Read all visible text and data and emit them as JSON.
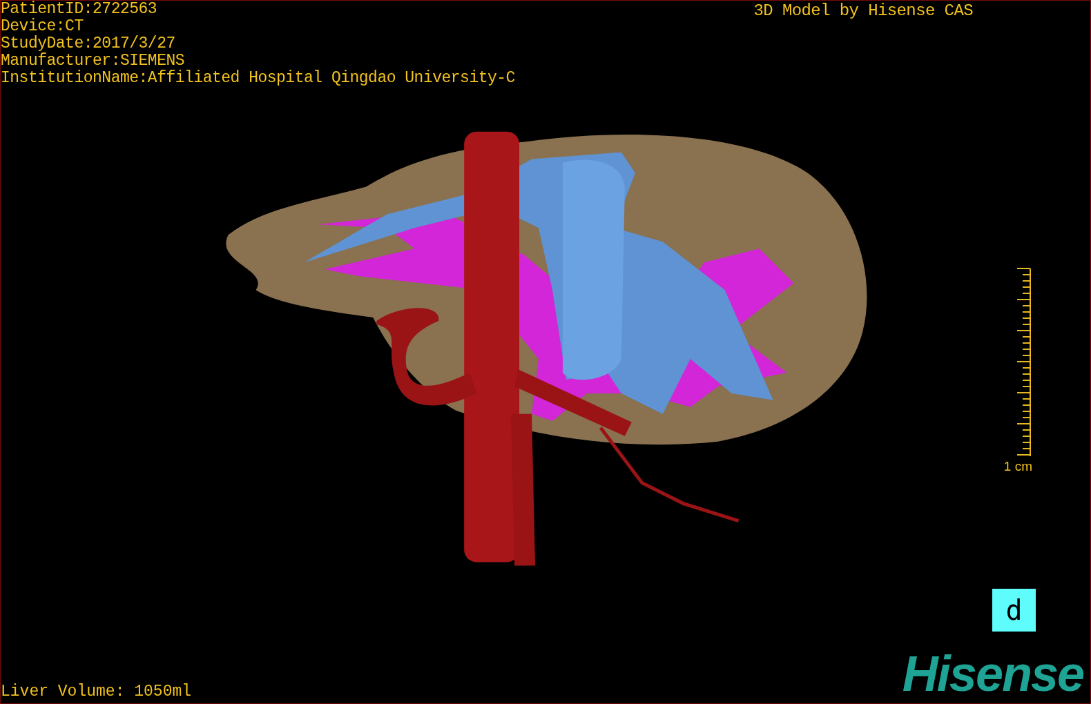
{
  "study_info": [
    "PatientID:2722563",
    "Device:CT",
    "StudyDate:2017/3/27",
    "Manufacturer:SIEMENS",
    "InstitutionName:Affiliated Hospital Qingdao University-C"
  ],
  "model_credit": "3D Model by Hisense CAS",
  "scale_bar": {
    "label": "1 cm"
  },
  "panel_label": "d",
  "logo": "Hisense",
  "liver_volume": "Liver Volume: 1050ml"
}
